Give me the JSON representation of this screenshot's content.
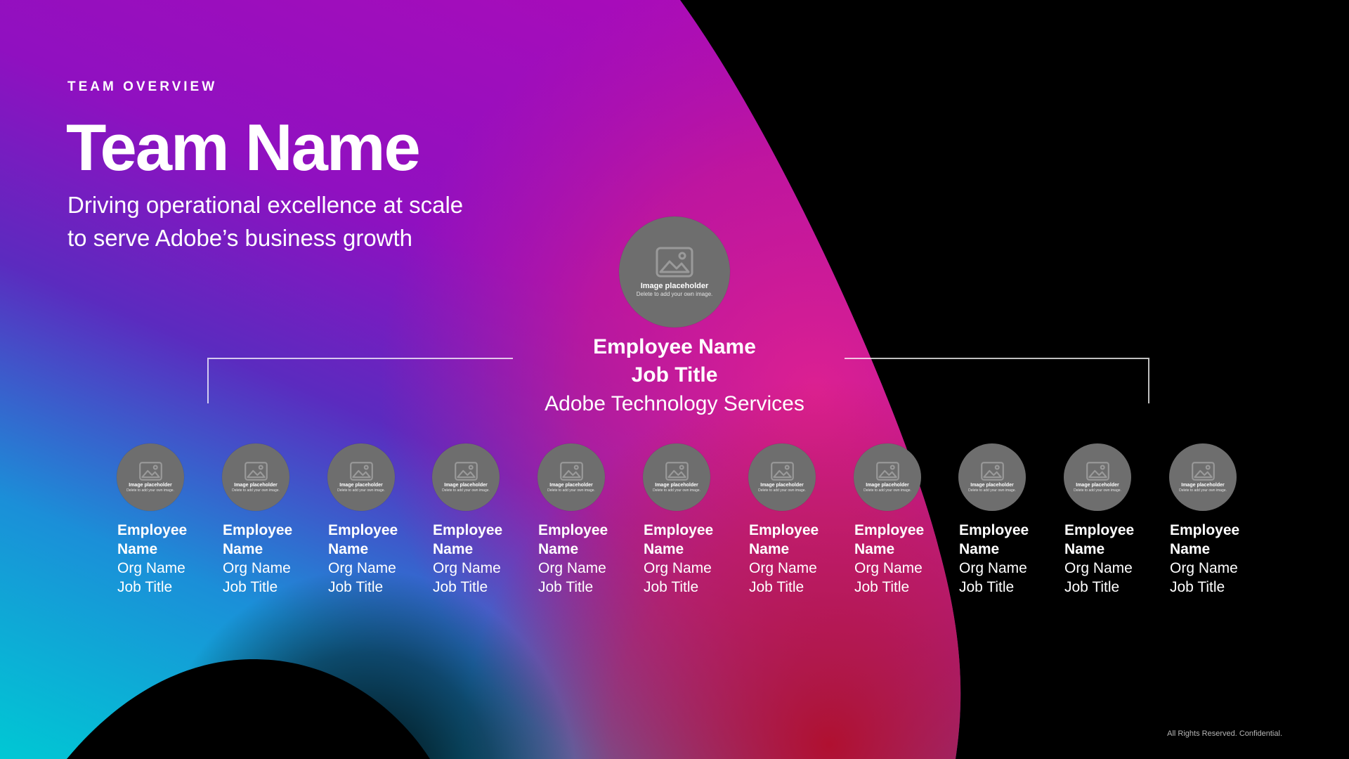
{
  "header": {
    "eyebrow": "TEAM OVERVIEW",
    "title": "Team Name",
    "subtitle_line1": "Driving operational excellence at scale",
    "subtitle_line2": "to serve Adobe’s business growth"
  },
  "leader": {
    "placeholder_title": "Image placeholder",
    "placeholder_sub": "Delete to add your own image.",
    "name": "Employee Name",
    "job_title": "Job Title",
    "org": "Adobe Technology Services"
  },
  "members": [
    {
      "first": "Employee",
      "last": "Name",
      "org": "Org Name",
      "job": "Job Title",
      "ph_title": "Image placeholder",
      "ph_sub": "Delete to add your own image."
    },
    {
      "first": "Employee",
      "last": "Name",
      "org": "Org Name",
      "job": "Job Title",
      "ph_title": "Image placeholder",
      "ph_sub": "Delete to add your own image."
    },
    {
      "first": "Employee",
      "last": "Name",
      "org": "Org Name",
      "job": "Job Title",
      "ph_title": "Image placeholder",
      "ph_sub": "Delete to add your own image."
    },
    {
      "first": "Employee",
      "last": "Name",
      "org": "Org Name",
      "job": "Job Title",
      "ph_title": "Image placeholder",
      "ph_sub": "Delete to add your own image."
    },
    {
      "first": "Employee",
      "last": "Name",
      "org": "Org Name",
      "job": "Job Title",
      "ph_title": "Image placeholder",
      "ph_sub": "Delete to add your own image."
    },
    {
      "first": "Employee",
      "last": "Name",
      "org": "Org Name",
      "job": "Job Title",
      "ph_title": "Image placeholder",
      "ph_sub": "Delete to add your own image."
    },
    {
      "first": "Employee",
      "last": "Name",
      "org": "Org Name",
      "job": "Job Title",
      "ph_title": "Image placeholder",
      "ph_sub": "Delete to add your own image."
    },
    {
      "first": "Employee",
      "last": "Name",
      "org": "Org Name",
      "job": "Job Title",
      "ph_title": "Image placeholder",
      "ph_sub": "Delete to add your own image."
    },
    {
      "first": "Employee",
      "last": "Name",
      "org": "Org Name",
      "job": "Job Title",
      "ph_title": "Image placeholder",
      "ph_sub": "Delete to add your own image."
    },
    {
      "first": "Employee",
      "last": "Name",
      "org": "Org Name",
      "job": "Job Title",
      "ph_title": "Image placeholder",
      "ph_sub": "Delete to add your own image."
    },
    {
      "first": "Employee",
      "last": "Name",
      "org": "Org Name",
      "job": "Job Title",
      "ph_title": "Image placeholder",
      "ph_sub": "Delete to add your own image."
    }
  ],
  "footer": {
    "text": "All Rights Reserved. Confidential."
  },
  "icons": {
    "placeholder": "image-icon"
  },
  "colors": {
    "background": "#000000",
    "placeholder_gray": "#6e6e6e",
    "violet": "#8a0cc0",
    "magenta": "#d01a9a",
    "crimson": "#b8133a",
    "cyan": "#00c3d2"
  }
}
